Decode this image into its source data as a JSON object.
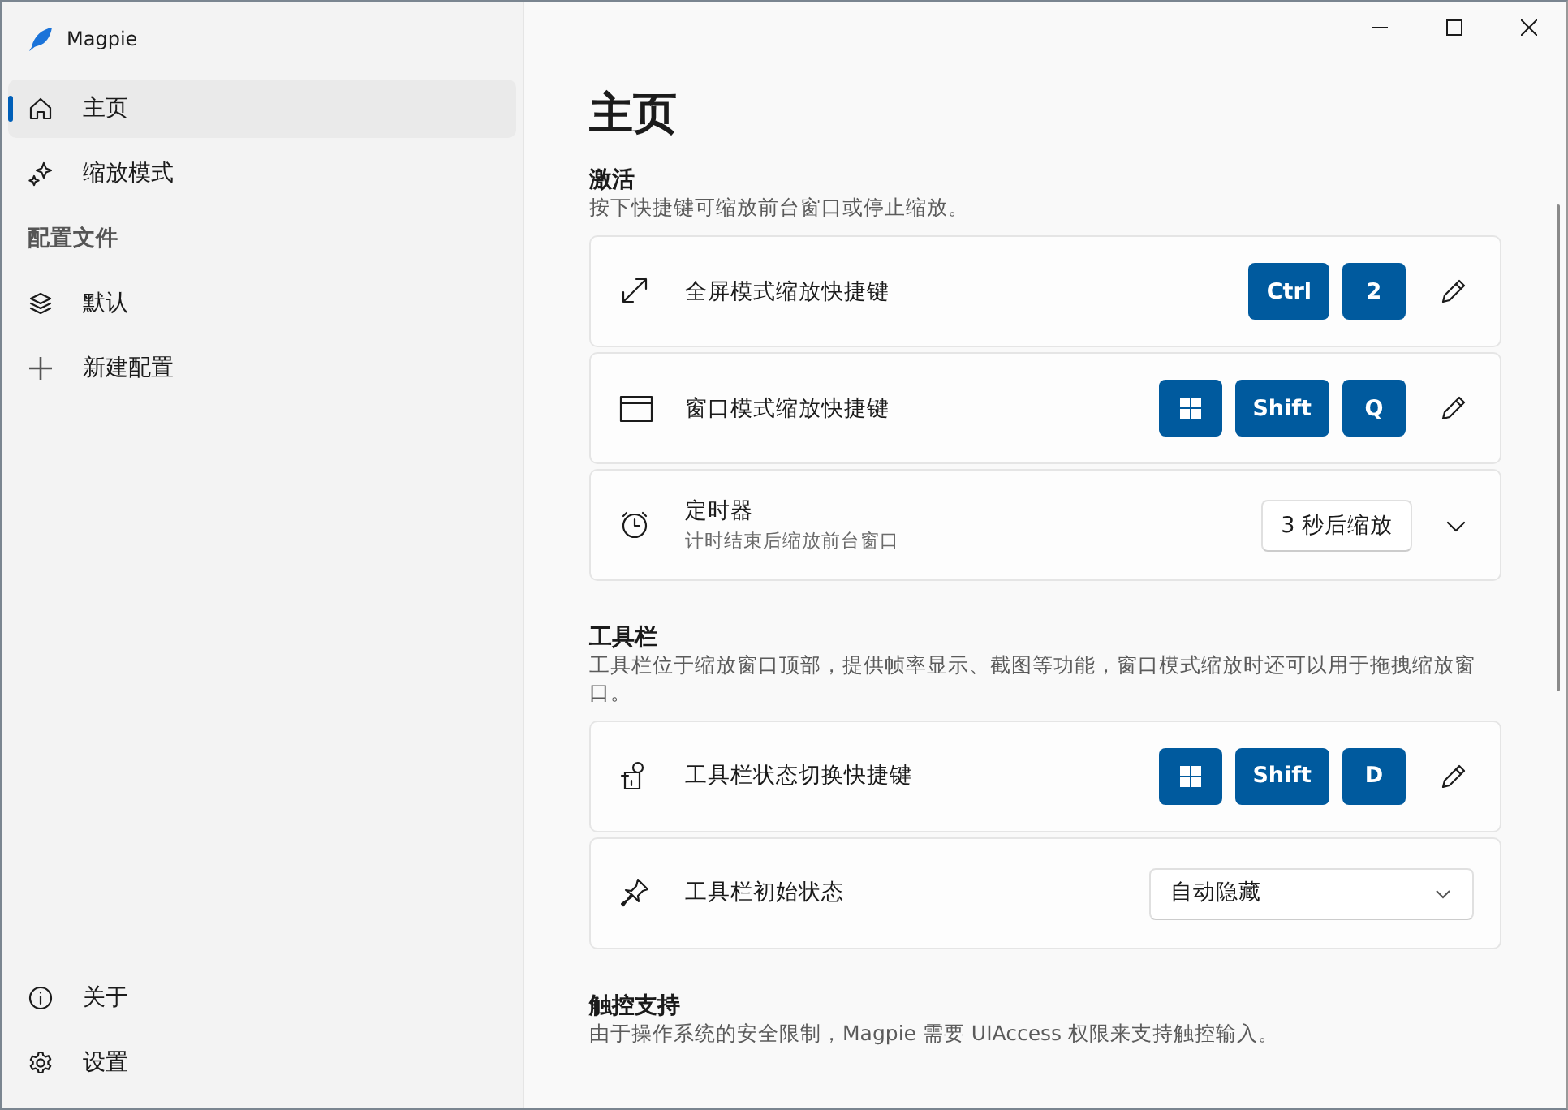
{
  "app": {
    "title": "Magpie"
  },
  "nav": {
    "items": [
      {
        "label": "主页",
        "selected": true
      },
      {
        "label": "缩放模式",
        "selected": false
      }
    ],
    "group_header": "配置文件",
    "profiles": [
      {
        "label": "默认",
        "selected": false
      },
      {
        "label": "新建配置",
        "selected": false
      }
    ],
    "footer": [
      {
        "label": "关于",
        "selected": false
      },
      {
        "label": "设置",
        "selected": false
      }
    ]
  },
  "page_title": "主页",
  "sections": [
    {
      "title": "激活",
      "description": "按下快捷键可缩放前台窗口或停止缩放。",
      "settings": [
        {
          "kind": "shortcut",
          "label": "全屏模式缩放快捷键",
          "keys": [
            {
              "kind": "text",
              "label": "Ctrl"
            },
            {
              "kind": "text",
              "label": "2"
            }
          ]
        },
        {
          "kind": "shortcut",
          "label": "窗口模式缩放快捷键",
          "keys": [
            {
              "kind": "logo"
            },
            {
              "kind": "text",
              "label": "Shift"
            },
            {
              "kind": "text",
              "label": "Q"
            }
          ]
        },
        {
          "kind": "expander",
          "label": "定时器",
          "description": "计时结束后缩放前台窗口",
          "button": "3 秒后缩放",
          "expanded": false
        }
      ]
    },
    {
      "title": "工具栏",
      "description": "工具栏位于缩放窗口顶部，提供帧率显示、截图等功能，窗口模式缩放时还可以用于拖拽缩放窗口。",
      "settings": [
        {
          "kind": "shortcut",
          "label": "工具栏状态切换快捷键",
          "keys": [
            {
              "kind": "logo"
            },
            {
              "kind": "text",
              "label": "Shift"
            },
            {
              "kind": "text",
              "label": "D"
            }
          ]
        },
        {
          "kind": "select",
          "label": "工具栏初始状态",
          "value": "自动隐藏"
        }
      ]
    },
    {
      "title": "触控支持",
      "description": "由于操作系统的安全限制，Magpie 需要 UIAccess 权限来支持触控输入。"
    }
  ]
}
